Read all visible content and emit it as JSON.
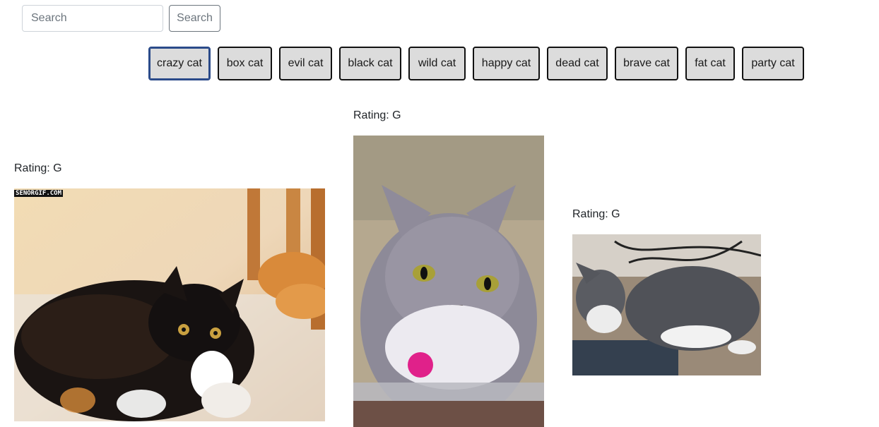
{
  "search": {
    "placeholder": "Search",
    "value": "",
    "button_label": "Search"
  },
  "tags": [
    {
      "label": "crazy cat",
      "active": true
    },
    {
      "label": "box cat",
      "active": false
    },
    {
      "label": "evil cat",
      "active": false
    },
    {
      "label": "black cat",
      "active": false
    },
    {
      "label": "wild cat",
      "active": false
    },
    {
      "label": "happy cat",
      "active": false
    },
    {
      "label": "dead cat",
      "active": false
    },
    {
      "label": "brave cat",
      "active": false
    },
    {
      "label": "fat cat",
      "active": false
    },
    {
      "label": "party cat",
      "active": false
    }
  ],
  "results": [
    {
      "rating": "Rating: G",
      "watermark": "SENORGIF.COM",
      "subject": "fluffy-black-calico-cat"
    },
    {
      "rating": "Rating: G",
      "subject": "grey-white-cat-at-window"
    },
    {
      "rating": "Rating: G",
      "subject": "grey-white-cat-lying-on-floor"
    }
  ],
  "colors": {
    "tag_background": "#dcdcdc",
    "tag_border": "#111111",
    "active_tag_border": "#2b4b8a",
    "search_button_text": "#6c757d"
  }
}
